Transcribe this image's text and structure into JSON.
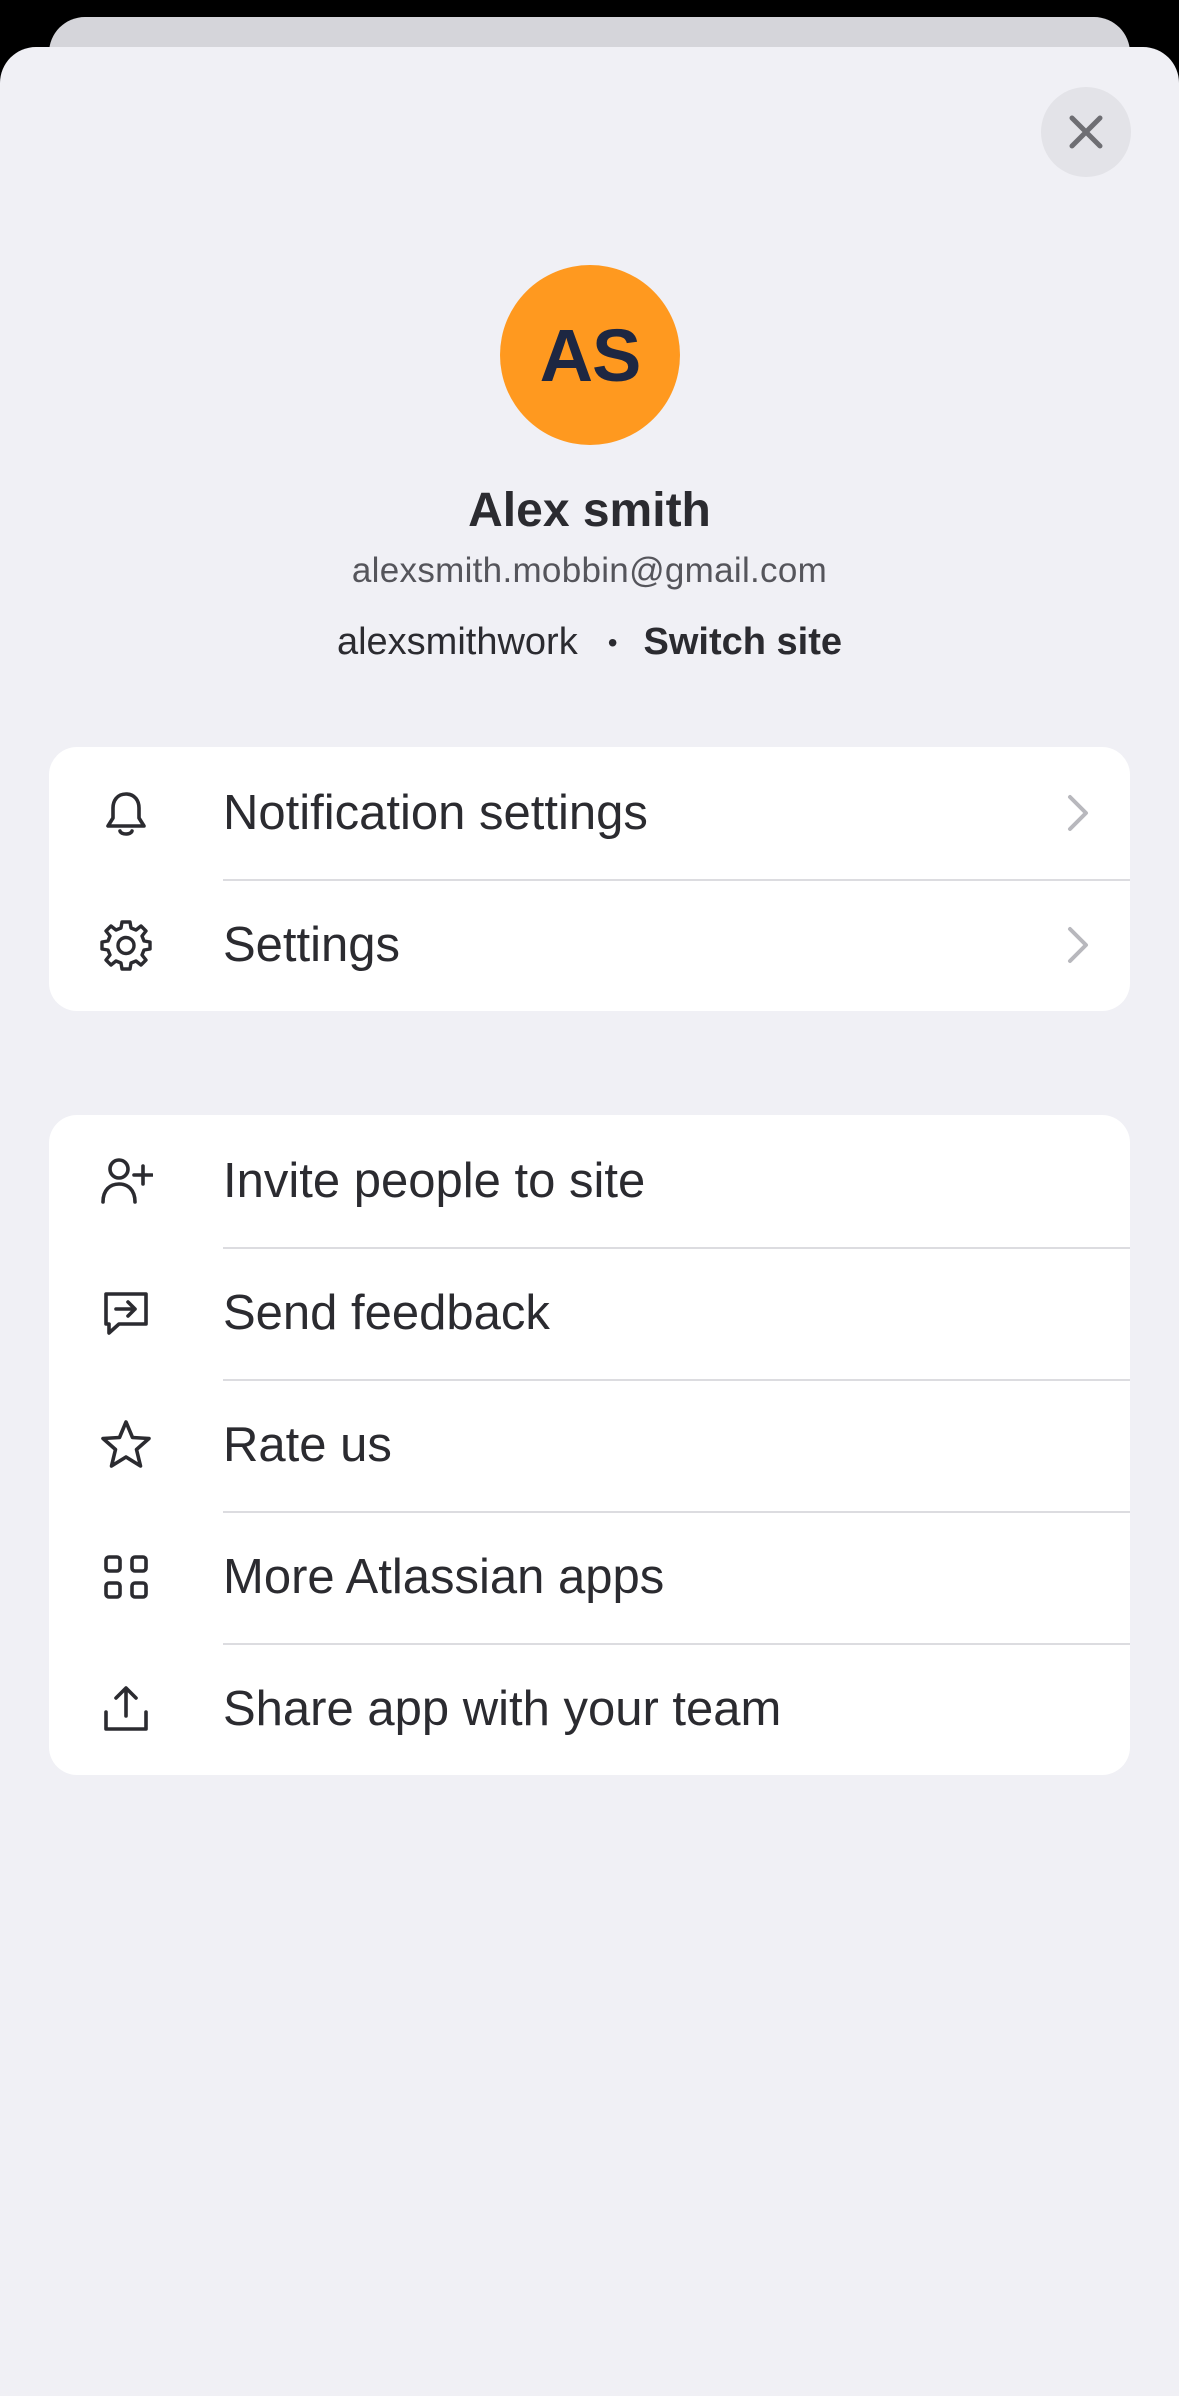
{
  "colors": {
    "avatar_bg": "#ff991f",
    "avatar_text": "#1d2742",
    "sheet_bg": "#f0f0f5",
    "card_bg": "#ffffff"
  },
  "close_button": {
    "icon": "close-icon"
  },
  "profile": {
    "initials": "AS",
    "name": "Alex smith",
    "email": "alexsmith.mobbin@gmail.com",
    "site": "alexsmithwork",
    "separator": "•",
    "switch_site_label": "Switch site"
  },
  "settings_group": {
    "items": [
      {
        "label": "Notification settings",
        "icon": "bell-icon",
        "has_chevron": true
      },
      {
        "label": "Settings",
        "icon": "gear-icon",
        "has_chevron": true
      }
    ]
  },
  "actions_group": {
    "items": [
      {
        "label": "Invite people to site",
        "icon": "add-person-icon"
      },
      {
        "label": "Send feedback",
        "icon": "feedback-icon"
      },
      {
        "label": "Rate us",
        "icon": "star-icon"
      },
      {
        "label": "More Atlassian apps",
        "icon": "apps-grid-icon"
      },
      {
        "label": "Share app with your team",
        "icon": "share-icon"
      }
    ]
  }
}
